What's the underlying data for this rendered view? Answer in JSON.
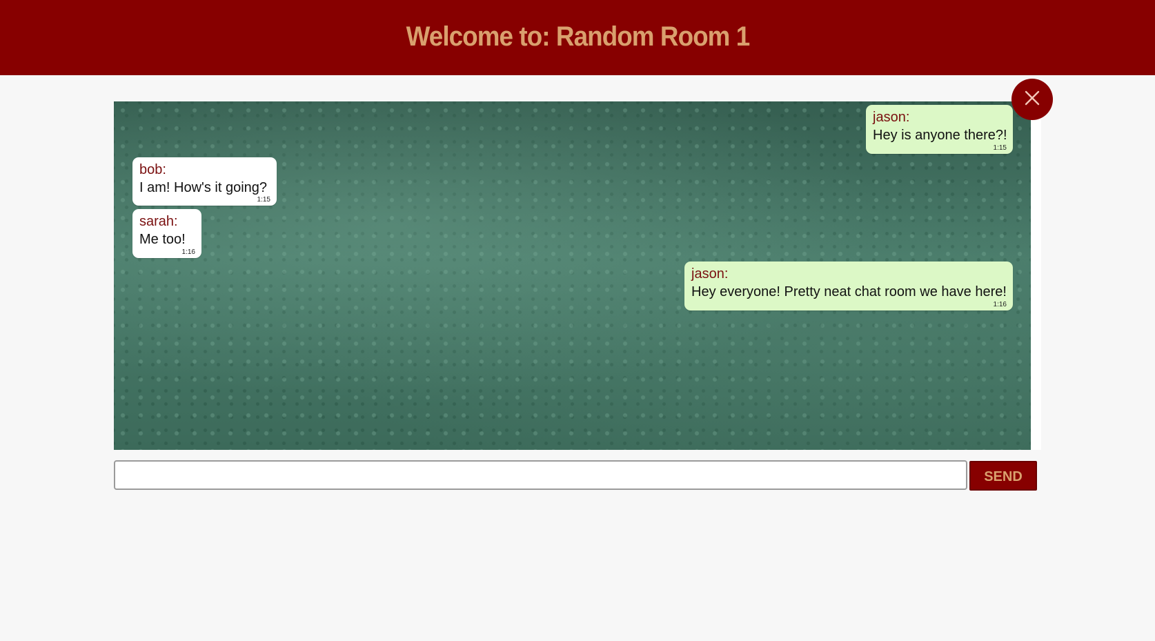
{
  "header": {
    "title": "Welcome to: Random Room 1"
  },
  "messages": [
    {
      "author": "jason:",
      "text": "Hey is anyone there?!",
      "time": "1:15",
      "own": true
    },
    {
      "author": "bob:",
      "text": "I am! How's it going?",
      "time": "1:15",
      "own": false
    },
    {
      "author": "sarah:",
      "text": "Me too!",
      "time": "1:16",
      "own": false
    },
    {
      "author": "jason:",
      "text": "Hey everyone! Pretty neat chat room we have here!",
      "time": "1:16",
      "own": true
    }
  ],
  "composer": {
    "placeholder": "",
    "value": "",
    "send_label": "SEND"
  },
  "colors": {
    "header_bg": "#870000",
    "header_text": "#d9a06e",
    "own_bubble": "#dcf8c6",
    "other_bubble": "#ffffff",
    "author_text": "#7a1010"
  },
  "icons": {
    "close": "close-icon"
  }
}
